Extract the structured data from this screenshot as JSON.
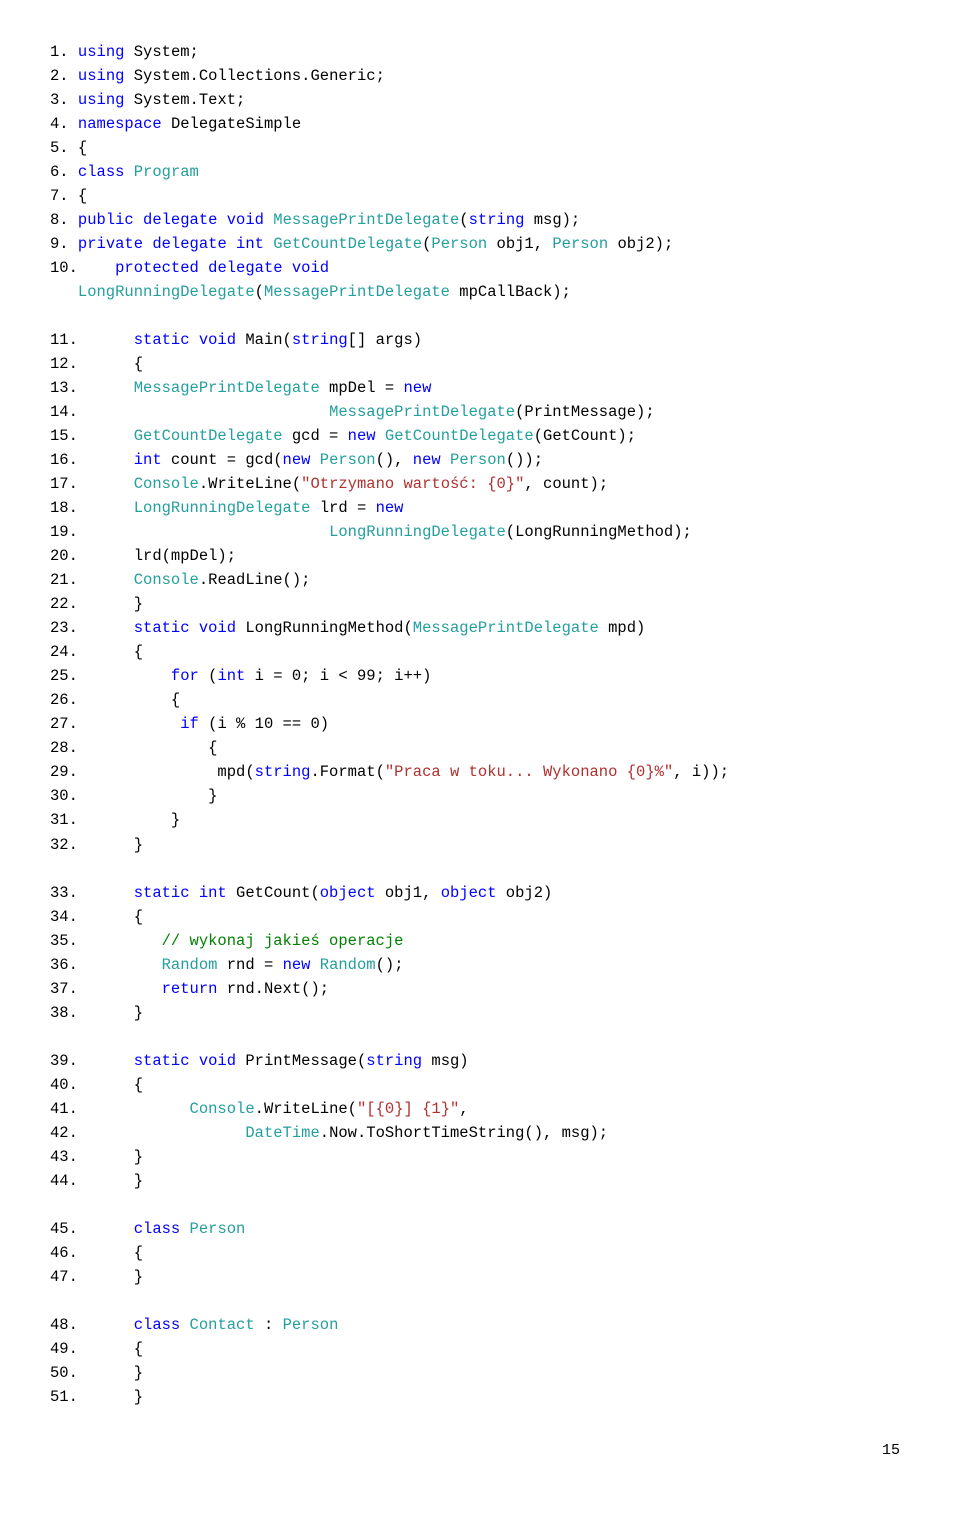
{
  "blocks": [
    {
      "lines": [
        {
          "n": "1.",
          "tokens": [
            {
              "t": " ",
              "c": ""
            },
            {
              "t": "using",
              "c": "kw"
            },
            {
              "t": " System;",
              "c": ""
            }
          ]
        },
        {
          "n": "2.",
          "tokens": [
            {
              "t": " ",
              "c": ""
            },
            {
              "t": "using",
              "c": "kw"
            },
            {
              "t": " System.Collections.Generic;",
              "c": ""
            }
          ]
        },
        {
          "n": "3.",
          "tokens": [
            {
              "t": " ",
              "c": ""
            },
            {
              "t": "using",
              "c": "kw"
            },
            {
              "t": " System.Text;",
              "c": ""
            }
          ]
        },
        {
          "n": "4.",
          "tokens": [
            {
              "t": " ",
              "c": ""
            },
            {
              "t": "namespace",
              "c": "kw"
            },
            {
              "t": " DelegateSimple",
              "c": ""
            }
          ]
        },
        {
          "n": "5.",
          "tokens": [
            {
              "t": " {",
              "c": ""
            }
          ]
        },
        {
          "n": "6.",
          "tokens": [
            {
              "t": " ",
              "c": ""
            },
            {
              "t": "class",
              "c": "kw"
            },
            {
              "t": " ",
              "c": ""
            },
            {
              "t": "Program",
              "c": "type"
            }
          ]
        },
        {
          "n": "7.",
          "tokens": [
            {
              "t": " {",
              "c": ""
            }
          ]
        },
        {
          "n": "8.",
          "tokens": [
            {
              "t": " ",
              "c": ""
            },
            {
              "t": "public delegate void",
              "c": "kw"
            },
            {
              "t": " ",
              "c": ""
            },
            {
              "t": "MessagePrintDelegate",
              "c": "type"
            },
            {
              "t": "(",
              "c": ""
            },
            {
              "t": "string",
              "c": "kw"
            },
            {
              "t": " msg);",
              "c": ""
            }
          ]
        },
        {
          "n": "9.",
          "tokens": [
            {
              "t": " ",
              "c": ""
            },
            {
              "t": "private delegate int",
              "c": "kw"
            },
            {
              "t": " ",
              "c": ""
            },
            {
              "t": "GetCountDelegate",
              "c": "type"
            },
            {
              "t": "(",
              "c": ""
            },
            {
              "t": "Person",
              "c": "type"
            },
            {
              "t": " obj1, ",
              "c": ""
            },
            {
              "t": "Person",
              "c": "type"
            },
            {
              "t": " obj2);",
              "c": ""
            }
          ]
        },
        {
          "n": "10.",
          "tokens": [
            {
              "t": "    ",
              "c": ""
            },
            {
              "t": "protected delegate void",
              "c": "kw"
            }
          ]
        },
        {
          "n": "",
          "tokens": [
            {
              "t": "   ",
              "c": ""
            },
            {
              "t": "LongRunningDelegate",
              "c": "type"
            },
            {
              "t": "(",
              "c": ""
            },
            {
              "t": "MessagePrintDelegate",
              "c": "type"
            },
            {
              "t": " mpCallBack);",
              "c": ""
            }
          ]
        }
      ]
    },
    {
      "lines": [
        {
          "n": "11.",
          "tokens": [
            {
              "t": "      ",
              "c": ""
            },
            {
              "t": "static void",
              "c": "kw"
            },
            {
              "t": " Main(",
              "c": ""
            },
            {
              "t": "string",
              "c": "kw"
            },
            {
              "t": "[] args)",
              "c": ""
            }
          ]
        },
        {
          "n": "12.",
          "tokens": [
            {
              "t": "      {",
              "c": ""
            }
          ]
        },
        {
          "n": "13.",
          "tokens": [
            {
              "t": "      ",
              "c": ""
            },
            {
              "t": "MessagePrintDelegate",
              "c": "type"
            },
            {
              "t": " mpDel = ",
              "c": ""
            },
            {
              "t": "new",
              "c": "kw"
            }
          ]
        },
        {
          "n": "14.",
          "tokens": [
            {
              "t": "                           ",
              "c": ""
            },
            {
              "t": "MessagePrintDelegate",
              "c": "type"
            },
            {
              "t": "(PrintMessage);",
              "c": ""
            }
          ]
        },
        {
          "n": "15.",
          "tokens": [
            {
              "t": "      ",
              "c": ""
            },
            {
              "t": "GetCountDelegate",
              "c": "type"
            },
            {
              "t": " gcd = ",
              "c": ""
            },
            {
              "t": "new",
              "c": "kw"
            },
            {
              "t": " ",
              "c": ""
            },
            {
              "t": "GetCountDelegate",
              "c": "type"
            },
            {
              "t": "(GetCount);",
              "c": ""
            }
          ]
        },
        {
          "n": "16.",
          "tokens": [
            {
              "t": "      ",
              "c": ""
            },
            {
              "t": "int",
              "c": "kw"
            },
            {
              "t": " count = gcd(",
              "c": ""
            },
            {
              "t": "new",
              "c": "kw"
            },
            {
              "t": " ",
              "c": ""
            },
            {
              "t": "Person",
              "c": "type"
            },
            {
              "t": "(), ",
              "c": ""
            },
            {
              "t": "new",
              "c": "kw"
            },
            {
              "t": " ",
              "c": ""
            },
            {
              "t": "Person",
              "c": "type"
            },
            {
              "t": "());",
              "c": ""
            }
          ]
        },
        {
          "n": "17.",
          "tokens": [
            {
              "t": "      ",
              "c": ""
            },
            {
              "t": "Console",
              "c": "type"
            },
            {
              "t": ".WriteLine(",
              "c": ""
            },
            {
              "t": "\"Otrzymano wartość: {0}\"",
              "c": "str"
            },
            {
              "t": ", count);",
              "c": ""
            }
          ]
        },
        {
          "n": "18.",
          "tokens": [
            {
              "t": "      ",
              "c": ""
            },
            {
              "t": "LongRunningDelegate",
              "c": "type"
            },
            {
              "t": " lrd = ",
              "c": ""
            },
            {
              "t": "new",
              "c": "kw"
            }
          ]
        },
        {
          "n": "19.",
          "tokens": [
            {
              "t": "                           ",
              "c": ""
            },
            {
              "t": "LongRunningDelegate",
              "c": "type"
            },
            {
              "t": "(LongRunningMethod);",
              "c": ""
            }
          ]
        },
        {
          "n": "20.",
          "tokens": [
            {
              "t": "      lrd(mpDel);",
              "c": ""
            }
          ]
        },
        {
          "n": "21.",
          "tokens": [
            {
              "t": "      ",
              "c": ""
            },
            {
              "t": "Console",
              "c": "type"
            },
            {
              "t": ".ReadLine();",
              "c": ""
            }
          ]
        },
        {
          "n": "22.",
          "tokens": [
            {
              "t": "      }",
              "c": ""
            }
          ]
        },
        {
          "n": "23.",
          "tokens": [
            {
              "t": "      ",
              "c": ""
            },
            {
              "t": "static void",
              "c": "kw"
            },
            {
              "t": " LongRunningMethod(",
              "c": ""
            },
            {
              "t": "MessagePrintDelegate",
              "c": "type"
            },
            {
              "t": " mpd)",
              "c": ""
            }
          ]
        },
        {
          "n": "24.",
          "tokens": [
            {
              "t": "      {",
              "c": ""
            }
          ]
        },
        {
          "n": "25.",
          "tokens": [
            {
              "t": "          ",
              "c": ""
            },
            {
              "t": "for",
              "c": "kw"
            },
            {
              "t": " (",
              "c": ""
            },
            {
              "t": "int",
              "c": "kw"
            },
            {
              "t": " i = 0; i < 99; i++)",
              "c": ""
            }
          ]
        },
        {
          "n": "26.",
          "tokens": [
            {
              "t": "          {",
              "c": ""
            }
          ]
        },
        {
          "n": "27.",
          "tokens": [
            {
              "t": "           ",
              "c": ""
            },
            {
              "t": "if",
              "c": "kw"
            },
            {
              "t": " (i % 10 == 0)",
              "c": ""
            }
          ]
        },
        {
          "n": "28.",
          "tokens": [
            {
              "t": "              {",
              "c": ""
            }
          ]
        },
        {
          "n": "29.",
          "tokens": [
            {
              "t": "               mpd(",
              "c": ""
            },
            {
              "t": "string",
              "c": "kw"
            },
            {
              "t": ".Format(",
              "c": ""
            },
            {
              "t": "\"Praca w toku... Wykonano {0}%\"",
              "c": "str"
            },
            {
              "t": ", i));",
              "c": ""
            }
          ]
        },
        {
          "n": "30.",
          "tokens": [
            {
              "t": "              }",
              "c": ""
            }
          ]
        },
        {
          "n": "31.",
          "tokens": [
            {
              "t": "          }",
              "c": ""
            }
          ]
        },
        {
          "n": "32.",
          "tokens": [
            {
              "t": "      }",
              "c": ""
            }
          ]
        }
      ]
    },
    {
      "lines": [
        {
          "n": "33.",
          "tokens": [
            {
              "t": "      ",
              "c": ""
            },
            {
              "t": "static int",
              "c": "kw"
            },
            {
              "t": " GetCount(",
              "c": ""
            },
            {
              "t": "object",
              "c": "kw"
            },
            {
              "t": " obj1, ",
              "c": ""
            },
            {
              "t": "object",
              "c": "kw"
            },
            {
              "t": " obj2)",
              "c": ""
            }
          ]
        },
        {
          "n": "34.",
          "tokens": [
            {
              "t": "      {",
              "c": ""
            }
          ]
        },
        {
          "n": "35.",
          "tokens": [
            {
              "t": "         ",
              "c": ""
            },
            {
              "t": "// wykonaj jakieś operacje",
              "c": "cmt"
            }
          ]
        },
        {
          "n": "36.",
          "tokens": [
            {
              "t": "         ",
              "c": ""
            },
            {
              "t": "Random",
              "c": "type"
            },
            {
              "t": " rnd = ",
              "c": ""
            },
            {
              "t": "new",
              "c": "kw"
            },
            {
              "t": " ",
              "c": ""
            },
            {
              "t": "Random",
              "c": "type"
            },
            {
              "t": "();",
              "c": ""
            }
          ]
        },
        {
          "n": "37.",
          "tokens": [
            {
              "t": "         ",
              "c": ""
            },
            {
              "t": "return",
              "c": "kw"
            },
            {
              "t": " rnd.Next();",
              "c": ""
            }
          ]
        },
        {
          "n": "38.",
          "tokens": [
            {
              "t": "      }",
              "c": ""
            }
          ]
        }
      ]
    },
    {
      "lines": [
        {
          "n": "39.",
          "tokens": [
            {
              "t": "      ",
              "c": ""
            },
            {
              "t": "static void",
              "c": "kw"
            },
            {
              "t": " PrintMessage(",
              "c": ""
            },
            {
              "t": "string",
              "c": "kw"
            },
            {
              "t": " msg)",
              "c": ""
            }
          ]
        },
        {
          "n": "40.",
          "tokens": [
            {
              "t": "      {",
              "c": ""
            }
          ]
        },
        {
          "n": "41.",
          "tokens": [
            {
              "t": "            ",
              "c": ""
            },
            {
              "t": "Console",
              "c": "type"
            },
            {
              "t": ".WriteLine(",
              "c": ""
            },
            {
              "t": "\"[{0}] {1}\"",
              "c": "str"
            },
            {
              "t": ",",
              "c": ""
            }
          ]
        },
        {
          "n": "42.",
          "tokens": [
            {
              "t": "                  ",
              "c": ""
            },
            {
              "t": "DateTime",
              "c": "type"
            },
            {
              "t": ".Now.ToShortTimeString(), msg);",
              "c": ""
            }
          ]
        },
        {
          "n": "43.",
          "tokens": [
            {
              "t": "      }",
              "c": ""
            }
          ]
        },
        {
          "n": "44.",
          "tokens": [
            {
              "t": "      }",
              "c": ""
            }
          ]
        }
      ]
    },
    {
      "lines": [
        {
          "n": "45.",
          "tokens": [
            {
              "t": "      ",
              "c": ""
            },
            {
              "t": "class",
              "c": "kw"
            },
            {
              "t": " ",
              "c": ""
            },
            {
              "t": "Person",
              "c": "type"
            }
          ]
        },
        {
          "n": "46.",
          "tokens": [
            {
              "t": "      {",
              "c": ""
            }
          ]
        },
        {
          "n": "47.",
          "tokens": [
            {
              "t": "      }",
              "c": ""
            }
          ]
        }
      ]
    },
    {
      "lines": [
        {
          "n": "48.",
          "tokens": [
            {
              "t": "      ",
              "c": ""
            },
            {
              "t": "class",
              "c": "kw"
            },
            {
              "t": " ",
              "c": ""
            },
            {
              "t": "Contact",
              "c": "type"
            },
            {
              "t": " : ",
              "c": ""
            },
            {
              "t": "Person",
              "c": "type"
            }
          ]
        },
        {
          "n": "49.",
          "tokens": [
            {
              "t": "      {",
              "c": ""
            }
          ]
        },
        {
          "n": "50.",
          "tokens": [
            {
              "t": "      }",
              "c": ""
            }
          ]
        },
        {
          "n": "51.",
          "tokens": [
            {
              "t": "      }",
              "c": ""
            }
          ]
        }
      ]
    }
  ],
  "page_number": "15"
}
